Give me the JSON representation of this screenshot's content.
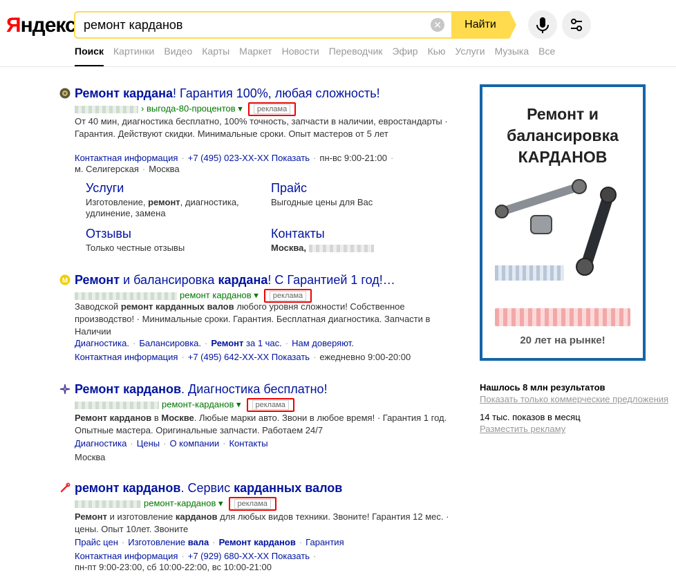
{
  "logo": {
    "ya": "Я",
    "rest": "ндекс"
  },
  "search": {
    "query": "ремонт карданов",
    "find_label": "Найти"
  },
  "tabs": [
    "Поиск",
    "Картинки",
    "Видео",
    "Карты",
    "Маркет",
    "Новости",
    "Переводчик",
    "Эфир",
    "Кью",
    "Услуги",
    "Музыка",
    "Все"
  ],
  "ad_label": "реклама",
  "results": [
    {
      "title_a": "Ремонт кардана",
      "title_b": "! Гарантия 100%, любая сложность!",
      "url_path": "› выгода-80-процентов",
      "snippet": "От 40 мин, диагностика бесплатно, 100% точность, запчасти в наличии, евростандарты · Гарантия. Действуют скидки. Минимальные сроки. Опыт мастеров от 5 лет",
      "contact": "Контактная информация",
      "phone": "+7 (495) 023-XX-XX",
      "show": "Показать",
      "hours": "пн-вс 9:00-21:00",
      "metro": "м. Селигерская",
      "city": "Москва",
      "sitelinks": [
        {
          "title": "Услуги",
          "desc_a": "Изготовление, ",
          "desc_b": "ремонт",
          "desc_c": ", диагностика, удлинение, замена"
        },
        {
          "title": "Прайс",
          "desc": "Выгодные цены для Вас"
        },
        {
          "title": "Отзывы",
          "desc": "Только честные отзывы"
        },
        {
          "title": "Контакты",
          "desc": "Москва,"
        }
      ]
    },
    {
      "title_a": "Ремонт",
      "title_b": " и балансировка ",
      "title_c": "кардана",
      "title_d": "! С Гарантией 1 год!…",
      "url_path": "ремонт карданов",
      "snippet_a": "Заводской ",
      "snippet_b": "ремонт карданных валов",
      "snippet_c": " любого уровня сложности! Собственное производство! · Минимальные сроки. Гарантия. Бесплатная диагностика. Запчасти в Наличии",
      "links": [
        "Диагностика.",
        "Балансировка.",
        "Ремонт",
        "за 1 час.",
        "Нам доверяют."
      ],
      "contact": "Контактная информация",
      "phone": "+7 (495) 642-XX-XX",
      "show": "Показать",
      "hours": "ежедневно 9:00-20:00"
    },
    {
      "title_a": "Ремонт карданов",
      "title_b": ". Диагностика бесплатно!",
      "url_path": "ремонт-карданов",
      "snippet_a": "Ремонт карданов",
      "snippet_b": " в ",
      "snippet_c": "Москве",
      "snippet_d": ". Любые марки авто. Звони в любое время! · Гарантия 1 год. Опытные мастера. Оригинальные запчасти. Работаем 24/7",
      "links": [
        "Диагностика",
        "Цены",
        "О компании",
        "Контакты"
      ],
      "city": "Москва"
    },
    {
      "title_a": "ремонт карданов",
      "title_b": ". Сервис ",
      "title_c": "карданных валов",
      "url_path": "ремонт-карданов",
      "snippet_a": "Ремонт",
      "snippet_b": " и изготовление ",
      "snippet_c": "карданов",
      "snippet_d": " для любых видов техники. Звоните! Гарантия 12 мес. · цены. Опыт 10лет. Звоните",
      "links_a": "Прайс цен",
      "links_b": "Изготовление ",
      "links_b2": "вала",
      "links_c": "Ремонт карданов",
      "links_d": "Гарантия",
      "contact": "Контактная информация",
      "phone": "+7 (929) 680-XX-XX",
      "show": "Показать",
      "hours": "пн-пт 9:00-23:00, сб 10:00-22:00, вс 10:00-21:00"
    }
  ],
  "banner": {
    "line1": "Ремонт и",
    "line2": "балансировка",
    "line3": "КАРДАНОВ",
    "sub": "20 лет на рынке!"
  },
  "side": {
    "found": "Нашлось 8 млн результатов",
    "commercial": "Показать только коммерческие предложения",
    "shows": "14 тыс. показов в месяц",
    "place_ad": "Разместить рекламу"
  }
}
